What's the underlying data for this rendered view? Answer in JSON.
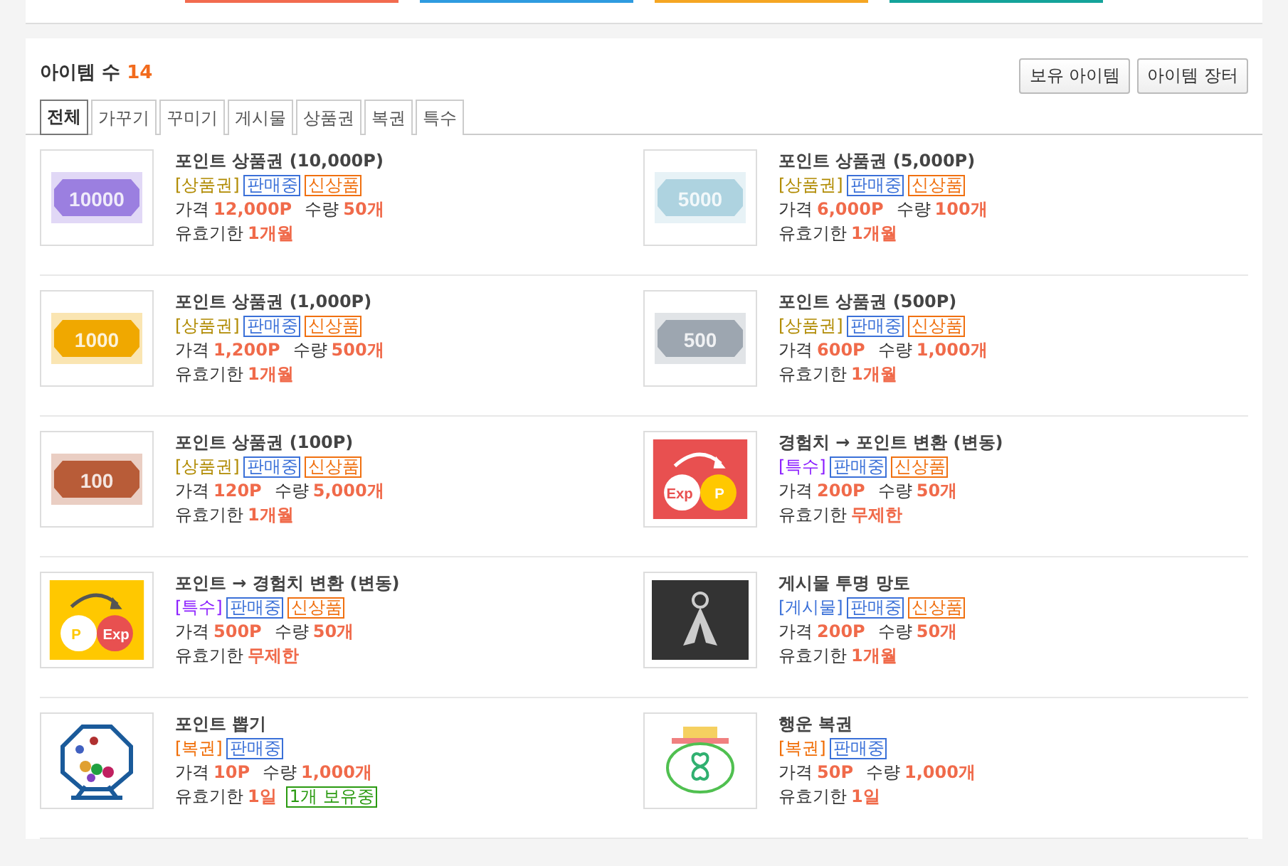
{
  "top_bars": [
    {
      "color": "#f26b4f"
    },
    {
      "color": "#2f9be0"
    },
    {
      "color": "#f5a623"
    },
    {
      "color": "#14a39a"
    }
  ],
  "header": {
    "title": "아이템 수",
    "count": "14",
    "buttons": [
      "보유 아이템",
      "아이템 장터"
    ]
  },
  "tabs": [
    {
      "label": "전체",
      "selected": true
    },
    {
      "label": "가꾸기",
      "selected": false
    },
    {
      "label": "꾸미기",
      "selected": false
    },
    {
      "label": "게시물",
      "selected": false
    },
    {
      "label": "상품권",
      "selected": false
    },
    {
      "label": "복권",
      "selected": false
    },
    {
      "label": "특수",
      "selected": false
    }
  ],
  "items": [
    {
      "name": "포인트 상품권 (10,000P)",
      "category": "[상품권]",
      "kind": "voucher",
      "tags": [
        {
          "label": "판매중",
          "kind": "sale"
        },
        {
          "label": "신상품",
          "kind": "new"
        }
      ],
      "price_label": "가격",
      "price": "12,000P",
      "qty_label": "수량",
      "qty": "50개",
      "expiry_label": "유효기한",
      "expiry": "1개월",
      "image": {
        "kind": "voucher",
        "color": "#9b7fe0",
        "text": "10000"
      }
    },
    {
      "name": "포인트 상품권 (5,000P)",
      "category": "[상품권]",
      "kind": "voucher",
      "tags": [
        {
          "label": "판매중",
          "kind": "sale"
        },
        {
          "label": "신상품",
          "kind": "new"
        }
      ],
      "price_label": "가격",
      "price": "6,000P",
      "qty_label": "수량",
      "qty": "100개",
      "expiry_label": "유효기한",
      "expiry": "1개월",
      "image": {
        "kind": "voucher",
        "color": "#aed3e0",
        "text": "5000"
      }
    },
    {
      "name": "포인트 상품권 (1,000P)",
      "category": "[상품권]",
      "kind": "voucher",
      "tags": [
        {
          "label": "판매중",
          "kind": "sale"
        },
        {
          "label": "신상품",
          "kind": "new"
        }
      ],
      "price_label": "가격",
      "price": "1,200P",
      "qty_label": "수량",
      "qty": "500개",
      "expiry_label": "유효기한",
      "expiry": "1개월",
      "image": {
        "kind": "voucher",
        "color": "#f0a800",
        "text": "1000"
      }
    },
    {
      "name": "포인트 상품권 (500P)",
      "category": "[상품권]",
      "kind": "voucher",
      "tags": [
        {
          "label": "판매중",
          "kind": "sale"
        },
        {
          "label": "신상품",
          "kind": "new"
        }
      ],
      "price_label": "가격",
      "price": "600P",
      "qty_label": "수량",
      "qty": "1,000개",
      "expiry_label": "유효기한",
      "expiry": "1개월",
      "image": {
        "kind": "voucher",
        "color": "#9da6b0",
        "text": "500"
      }
    },
    {
      "name": "포인트 상품권 (100P)",
      "category": "[상품권]",
      "kind": "voucher",
      "tags": [
        {
          "label": "판매중",
          "kind": "sale"
        },
        {
          "label": "신상품",
          "kind": "new"
        }
      ],
      "price_label": "가격",
      "price": "120P",
      "qty_label": "수량",
      "qty": "5,000개",
      "expiry_label": "유효기한",
      "expiry": "1개월",
      "image": {
        "kind": "voucher",
        "color": "#b85c38",
        "text": "100"
      }
    },
    {
      "name": "경험치 → 포인트 변환 (변동)",
      "category": "[특수]",
      "kind": "special",
      "tags": [
        {
          "label": "판매중",
          "kind": "sale"
        },
        {
          "label": "신상품",
          "kind": "new"
        }
      ],
      "price_label": "가격",
      "price": "200P",
      "qty_label": "수량",
      "qty": "50개",
      "expiry_label": "유효기한",
      "expiry": "무제한",
      "image": {
        "kind": "exp-to-point",
        "texts": [
          "Exp",
          "P"
        ]
      }
    },
    {
      "name": "포인트 → 경험치 변환 (변동)",
      "category": "[특수]",
      "kind": "special",
      "tags": [
        {
          "label": "판매중",
          "kind": "sale"
        },
        {
          "label": "신상품",
          "kind": "new"
        }
      ],
      "price_label": "가격",
      "price": "500P",
      "qty_label": "수량",
      "qty": "50개",
      "expiry_label": "유효기한",
      "expiry": "무제한",
      "image": {
        "kind": "point-to-exp",
        "texts": [
          "P",
          "Exp"
        ]
      }
    },
    {
      "name": "게시물 투명 망토",
      "category": "[게시물]",
      "kind": "post",
      "tags": [
        {
          "label": "판매중",
          "kind": "sale"
        },
        {
          "label": "신상품",
          "kind": "new"
        }
      ],
      "price_label": "가격",
      "price": "200P",
      "qty_label": "수량",
      "qty": "50개",
      "expiry_label": "유효기한",
      "expiry": "1개월",
      "image": {
        "kind": "cloak"
      }
    },
    {
      "name": "포인트 뽑기",
      "category": "[복권]",
      "kind": "lottery",
      "tags": [
        {
          "label": "판매중",
          "kind": "sale"
        }
      ],
      "price_label": "가격",
      "price": "10P",
      "qty_label": "수량",
      "qty": "1,000개",
      "expiry_label": "유효기한",
      "expiry": "1일",
      "owned": "1개 보유중",
      "image": {
        "kind": "lottery-machine"
      }
    },
    {
      "name": "행운 복권",
      "category": "[복권]",
      "kind": "lottery",
      "tags": [
        {
          "label": "판매중",
          "kind": "sale"
        }
      ],
      "price_label": "가격",
      "price": "50P",
      "qty_label": "수량",
      "qty": "1,000개",
      "expiry_label": "유효기한",
      "expiry": "1일",
      "image": {
        "kind": "pot"
      }
    }
  ]
}
